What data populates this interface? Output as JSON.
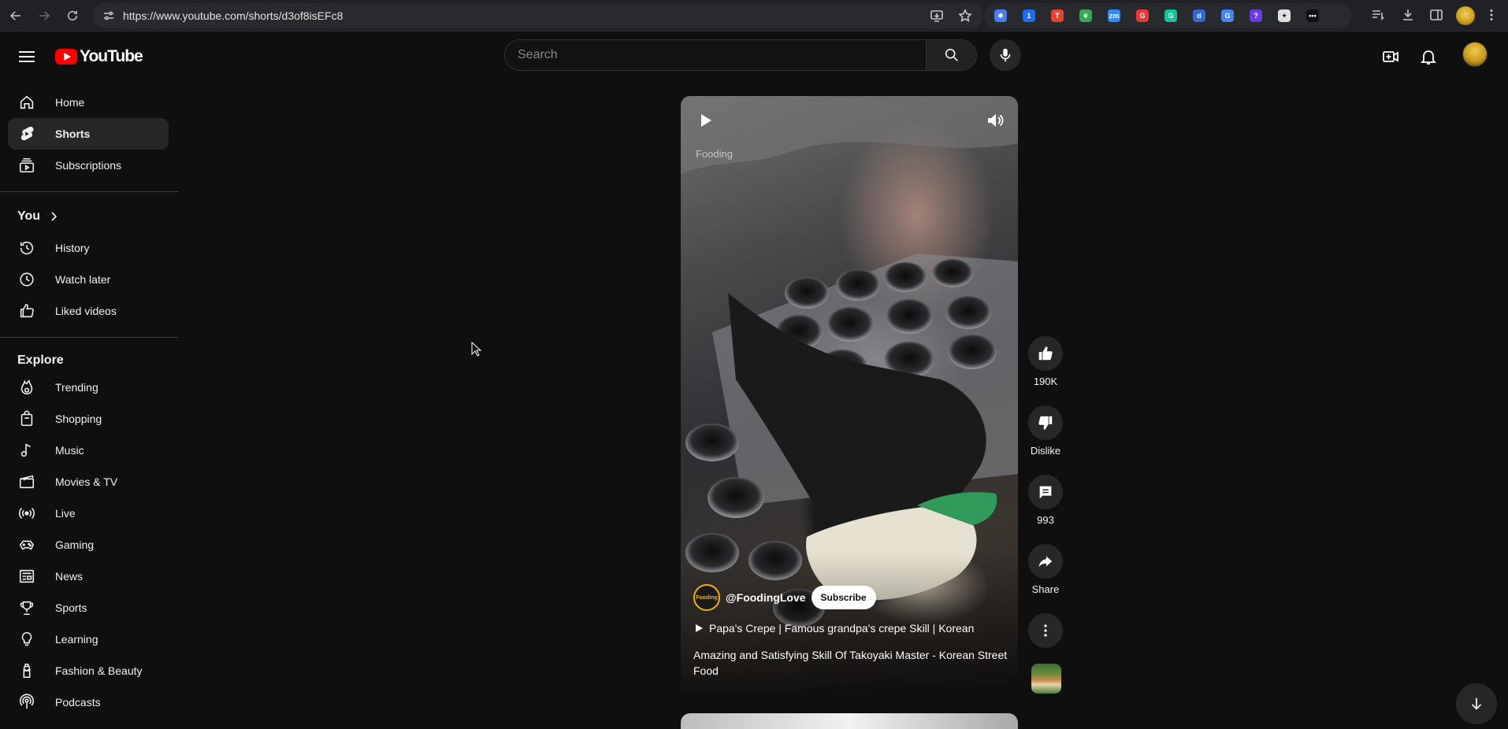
{
  "browser": {
    "url": "https://www.youtube.com/shorts/d3of8isEFc8",
    "extensions": [
      {
        "icon": "gear-ext-icon",
        "color": "#4a7bf7",
        "glyph": "✱"
      },
      {
        "icon": "1password-icon",
        "color": "#1a6ef5",
        "glyph": "1"
      },
      {
        "icon": "todoist-icon",
        "color": "#e44332",
        "glyph": "T"
      },
      {
        "icon": "leaf-ext-icon",
        "color": "#34a853",
        "glyph": "❦"
      },
      {
        "icon": "zm-ext-icon",
        "color": "#2d8cff",
        "glyph": "zm"
      },
      {
        "icon": "red-g-ext-icon",
        "color": "#e53935",
        "glyph": "G"
      },
      {
        "icon": "grammarly-icon",
        "color": "#15c39a",
        "glyph": "G"
      },
      {
        "icon": "d-ext-icon",
        "color": "#3367d6",
        "glyph": "d"
      },
      {
        "icon": "translate-icon",
        "color": "#4285f4",
        "glyph": "G"
      },
      {
        "icon": "purple-ext-icon",
        "color": "#6c3ce0",
        "glyph": "?"
      },
      {
        "icon": "chatgpt-icon",
        "color": "#e0e0e0",
        "glyph": "✦"
      },
      {
        "icon": "dots-ext-icon",
        "color": "#111111",
        "glyph": "•••"
      },
      {
        "icon": "extensions-puzzle-icon",
        "color": "#282a2d",
        "glyph": ""
      }
    ]
  },
  "masthead": {
    "logo_text": "YouTube",
    "search_placeholder": "Search"
  },
  "sidebar": {
    "main": [
      {
        "label": "Home",
        "icon": "home-icon"
      },
      {
        "label": "Shorts",
        "icon": "shorts-icon",
        "active": true
      },
      {
        "label": "Subscriptions",
        "icon": "subscriptions-icon"
      }
    ],
    "you_heading": "You",
    "you": [
      {
        "label": "History",
        "icon": "history-icon"
      },
      {
        "label": "Watch later",
        "icon": "watch-later-icon"
      },
      {
        "label": "Liked videos",
        "icon": "liked-videos-icon"
      }
    ],
    "explore_heading": "Explore",
    "explore": [
      {
        "label": "Trending",
        "icon": "trending-icon"
      },
      {
        "label": "Shopping",
        "icon": "shopping-icon"
      },
      {
        "label": "Music",
        "icon": "music-icon"
      },
      {
        "label": "Movies & TV",
        "icon": "movies-icon"
      },
      {
        "label": "Live",
        "icon": "live-icon"
      },
      {
        "label": "Gaming",
        "icon": "gaming-icon"
      },
      {
        "label": "News",
        "icon": "news-icon"
      },
      {
        "label": "Sports",
        "icon": "sports-icon"
      },
      {
        "label": "Learning",
        "icon": "learning-icon"
      },
      {
        "label": "Fashion & Beauty",
        "icon": "fashion-icon"
      },
      {
        "label": "Podcasts",
        "icon": "podcasts-icon"
      }
    ]
  },
  "short": {
    "watermark": "Fooding",
    "channel_handle": "@FoodingLove",
    "channel_avatar_text": "Fooding",
    "subscribe_label": "Subscribe",
    "playlist_text": "Papa's Crepe | Famous grandpa's crepe Skill | Korean",
    "title": "Amazing and Satisfying Skill Of Takoyaki Master - Korean Street Food"
  },
  "actions": {
    "like_count": "190K",
    "dislike_label": "Dislike",
    "comment_count": "993",
    "share_label": "Share"
  }
}
